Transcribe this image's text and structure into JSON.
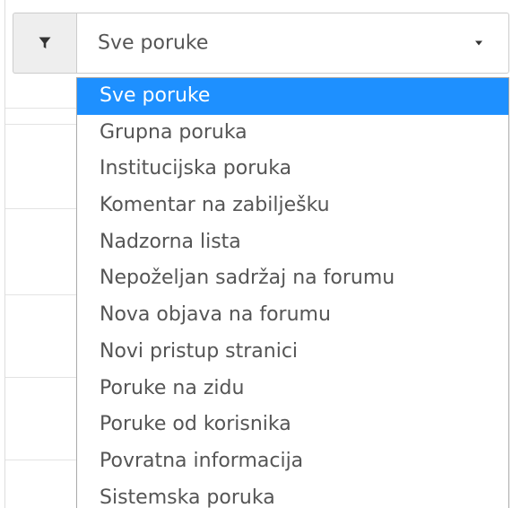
{
  "filter": {
    "icon": "filter-icon",
    "selected_value": "Sve poruke",
    "highlight_color": "#1e90ff",
    "options": [
      "Sve poruke",
      "Grupna poruka",
      "Institucijska poruka",
      "Komentar na zabilješku",
      "Nadzorna lista",
      "Nepoželjan sadržaj na forumu",
      "Nova objava na forumu",
      "Novi pristup stranici",
      "Poruke na zidu",
      "Poruke od korisnika",
      "Povratna informacija",
      "Sistemska poruka"
    ]
  }
}
